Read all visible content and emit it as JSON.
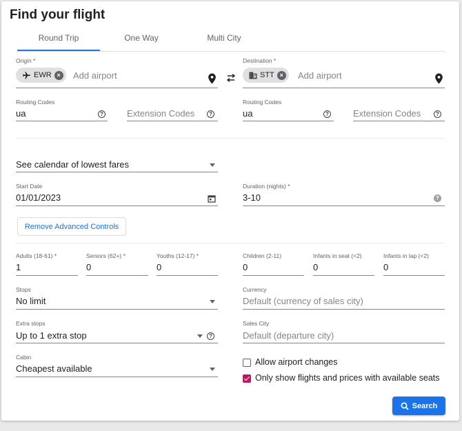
{
  "title": "Find your flight",
  "tabs": [
    {
      "label": "Round Trip",
      "active": true
    },
    {
      "label": "One Way",
      "active": false
    },
    {
      "label": "Multi City",
      "active": false
    }
  ],
  "origin": {
    "label": "Origin *",
    "chip": "EWR",
    "placeholder": "Add airport"
  },
  "destination": {
    "label": "Destination *",
    "chip": "STT",
    "placeholder": "Add airport"
  },
  "routing_left": {
    "label": "Routing Codes",
    "value": "ua",
    "ext_placeholder": "Extension Codes"
  },
  "routing_right": {
    "label": "Routing Codes",
    "value": "ua",
    "ext_placeholder": "Extension Codes"
  },
  "calendar": {
    "value": "See calendar of lowest fares"
  },
  "start_date": {
    "label": "Start Date",
    "value": "01/01/2023"
  },
  "duration": {
    "label": "Duration (nights) *",
    "value": "3-10"
  },
  "advanced_button": "Remove Advanced Controls",
  "passengers": [
    {
      "label": "Adults (18-61) *",
      "value": "1"
    },
    {
      "label": "Seniors (62+) *",
      "value": "0"
    },
    {
      "label": "Youths (12-17) *",
      "value": "0"
    },
    {
      "label": "Children (2-11)",
      "value": "0"
    },
    {
      "label": "Infants in seat (<2)",
      "value": "0"
    },
    {
      "label": "Infants in lap (<2)",
      "value": "0"
    }
  ],
  "stops": {
    "label": "Stops",
    "value": "No limit"
  },
  "currency": {
    "label": "Currency",
    "placeholder": "Default (currency of sales city)"
  },
  "extra_stops": {
    "label": "Extra stops",
    "value": "Up to 1 extra stop"
  },
  "sales_city": {
    "label": "Sales City",
    "placeholder": "Default (departure city)"
  },
  "cabin": {
    "label": "Cabin",
    "value": "Cheapest available"
  },
  "checkboxes": [
    {
      "label": "Allow airport changes",
      "checked": false
    },
    {
      "label": "Only show flights and prices with available seats",
      "checked": true
    }
  ],
  "search_button": "Search",
  "colors": {
    "accent": "#1a73e8",
    "checkbox": "#c2185b"
  }
}
